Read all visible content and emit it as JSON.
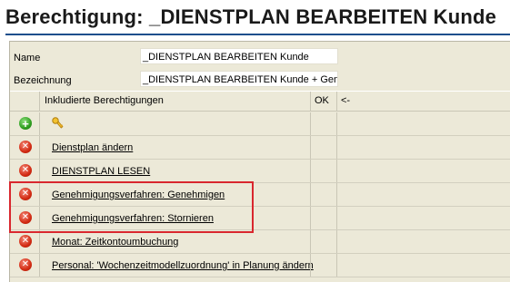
{
  "title": "Berechtigung: _DIENSTPLAN BEARBEITEN Kunde",
  "fields": {
    "name_label": "Name",
    "name_value": "_DIENSTPLAN BEARBEITEN Kunde",
    "bezeichnung_label": "Bezeichnung",
    "bezeichnung_value": "_DIENSTPLAN BEARBEITEN Kunde + Gene"
  },
  "grid": {
    "columns": [
      "Inkludierte Berechtigungen",
      "OK",
      "<-"
    ],
    "toolbar_icons": [
      "add-icon",
      "key-icon"
    ],
    "rows": [
      "Dienstplan ändern",
      "DIENSTPLAN LESEN",
      "Genehmigungsverfahren: Genehmigen",
      "Genehmigungsverfahren: Stornieren",
      "Monat: Zeitkontoumbuchung",
      "Personal: 'Wochenzeitmodellzuordnung' in Planung ändern"
    ],
    "row_icon": "delete-icon"
  },
  "colors": {
    "highlight": "#d9272e",
    "title_line": "#1c4e8c",
    "panel": "#ece9d8"
  }
}
